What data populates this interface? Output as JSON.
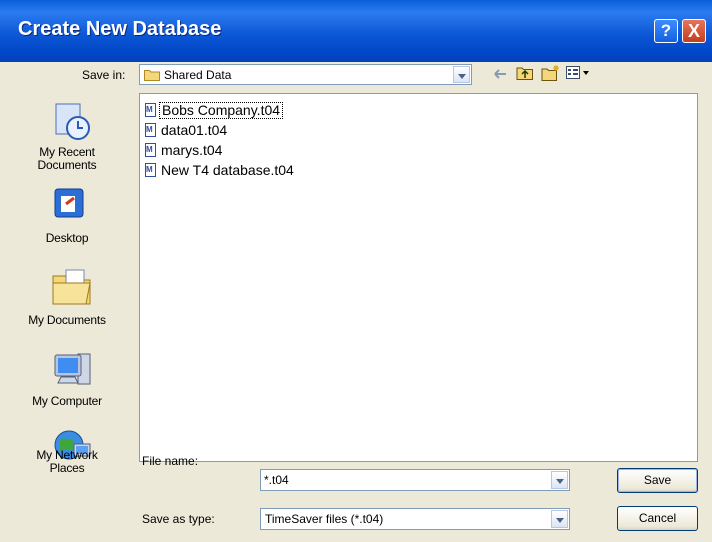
{
  "window": {
    "title": "Create New Database",
    "help": "?",
    "close": "X"
  },
  "save_in": {
    "label": "Save in:",
    "value": "Shared Data"
  },
  "toolbar": {
    "back": "back-icon",
    "up": "up-folder-icon",
    "new_folder": "new-folder-icon",
    "views": "views-menu-icon"
  },
  "places": [
    {
      "label_l1": "My Recent",
      "label_l2": "Documents",
      "icon": "recent-documents-icon"
    },
    {
      "label_l1": "Desktop",
      "label_l2": "",
      "icon": "desktop-icon"
    },
    {
      "label_l1": "My Documents",
      "label_l2": "",
      "icon": "my-documents-icon"
    },
    {
      "label_l1": "My Computer",
      "label_l2": "",
      "icon": "my-computer-icon"
    },
    {
      "label_l1": "My Network",
      "label_l2": "Places",
      "icon": "network-places-icon"
    }
  ],
  "files": [
    {
      "name": "Bobs Company.t04"
    },
    {
      "name": "data01.t04"
    },
    {
      "name": "marys.t04"
    },
    {
      "name": "New T4 database.t04"
    }
  ],
  "file_name": {
    "label": "File name:",
    "value": "*.t04"
  },
  "save_as_type": {
    "label": "Save as type:",
    "value": "TimeSaver files (*.t04)"
  },
  "buttons": {
    "save": "Save",
    "cancel": "Cancel"
  }
}
